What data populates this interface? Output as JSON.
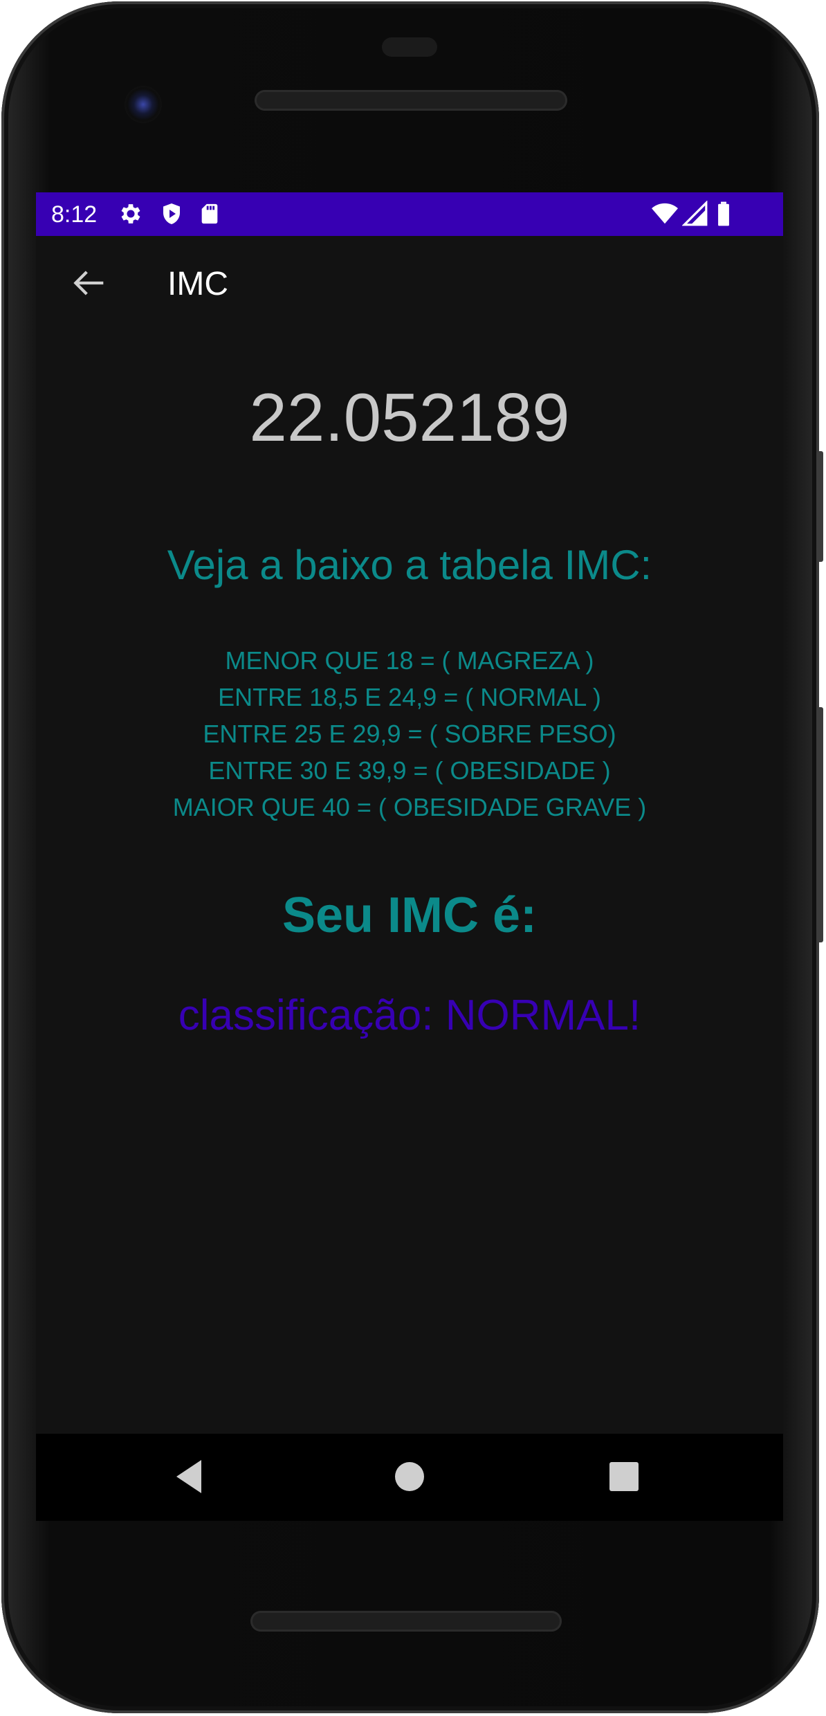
{
  "status_bar": {
    "time": "8:12",
    "left_icons": [
      "gear-icon",
      "shield-icon",
      "sd-card-icon"
    ],
    "right_icons": [
      "wifi-icon",
      "cell-signal-icon",
      "battery-icon"
    ],
    "background_color": "#3700b3"
  },
  "app_bar": {
    "title": "IMC",
    "back_icon": "arrow-left-icon"
  },
  "main": {
    "bmi_value": "22.052189",
    "table_title": "Veja a baixo a tabela IMC:",
    "table_lines": [
      "MENOR QUE 18 = ( MAGREZA )",
      "ENTRE 18,5 E 24,9 = ( NORMAL )",
      "ENTRE 25 E 29,9 = ( SOBRE PESO)",
      "ENTRE 30 E 39,9 = ( OBESIDADE )",
      "MAIOR QUE 40 = ( OBESIDADE GRAVE )"
    ],
    "result_heading": "Seu IMC é:",
    "classification": "classificação: NORMAL!"
  },
  "colors": {
    "teal": "#0b8a8a",
    "purple": "#3700b3",
    "screen_bg": "#121212"
  },
  "nav_bar": {
    "buttons": [
      "back-triangle-icon",
      "home-circle-icon",
      "recents-square-icon"
    ]
  }
}
